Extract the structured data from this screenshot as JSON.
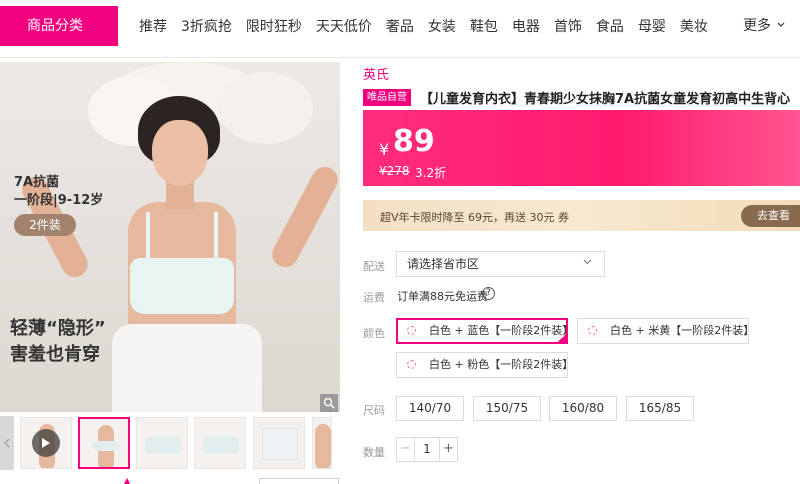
{
  "nav": {
    "category_button": "商品分类",
    "items": [
      "推荐",
      "3折疯抢",
      "限时狂秒",
      "天天低价",
      "奢品",
      "女装",
      "鞋包",
      "电器",
      "首饰",
      "食品",
      "母婴",
      "美妆"
    ],
    "more_label": "更多",
    "more_icon": "chevron-down-icon"
  },
  "gallery": {
    "hero_tag_line1": "7A抗菌",
    "hero_tag_line2": "一阶段|9-12岁",
    "hero_pill": "2件装",
    "hero_slogan_line1": "轻薄“隐形”",
    "hero_slogan_line2": "害羞也肯穿",
    "zoom_icon": "magnifier-icon",
    "play_icon": "play-icon",
    "selected_thumbnail": 2
  },
  "product": {
    "brand": "英氏",
    "badge": "唯品自营",
    "title": "【儿童发育内衣】青春期少女抹胸7A抗菌女童发育初高中生背心",
    "price_currency": "¥",
    "price": "89",
    "original_price": "¥278",
    "discount": "3.2折",
    "vip_promo": "超V年卡限时降至 69元，再送 30元 券",
    "vip_button": "去查看"
  },
  "options": {
    "delivery_label": "配送",
    "delivery_placeholder": "请选择省市区",
    "shipping_label": "运费",
    "shipping_text": "订单满88元免运费",
    "color_label": "颜色",
    "colors": [
      {
        "label": "白色 + 蓝色【一阶段2件装】",
        "selected": true
      },
      {
        "label": "白色 + 米黄【一阶段2件装】",
        "selected": false
      },
      {
        "label": "白色 + 粉色【一阶段2件装】",
        "selected": false
      }
    ],
    "size_label": "尺码",
    "sizes": [
      "140/70",
      "150/75",
      "160/80",
      "165/85"
    ],
    "quantity_label": "数量",
    "quantity": "1",
    "minus": "−",
    "plus": "+"
  },
  "colors": {
    "brand_pink": "#f10180",
    "price_bg": "#ff2c7d",
    "vip_bg": "#f3e0c4",
    "vip_button": "#8a6a4e"
  }
}
